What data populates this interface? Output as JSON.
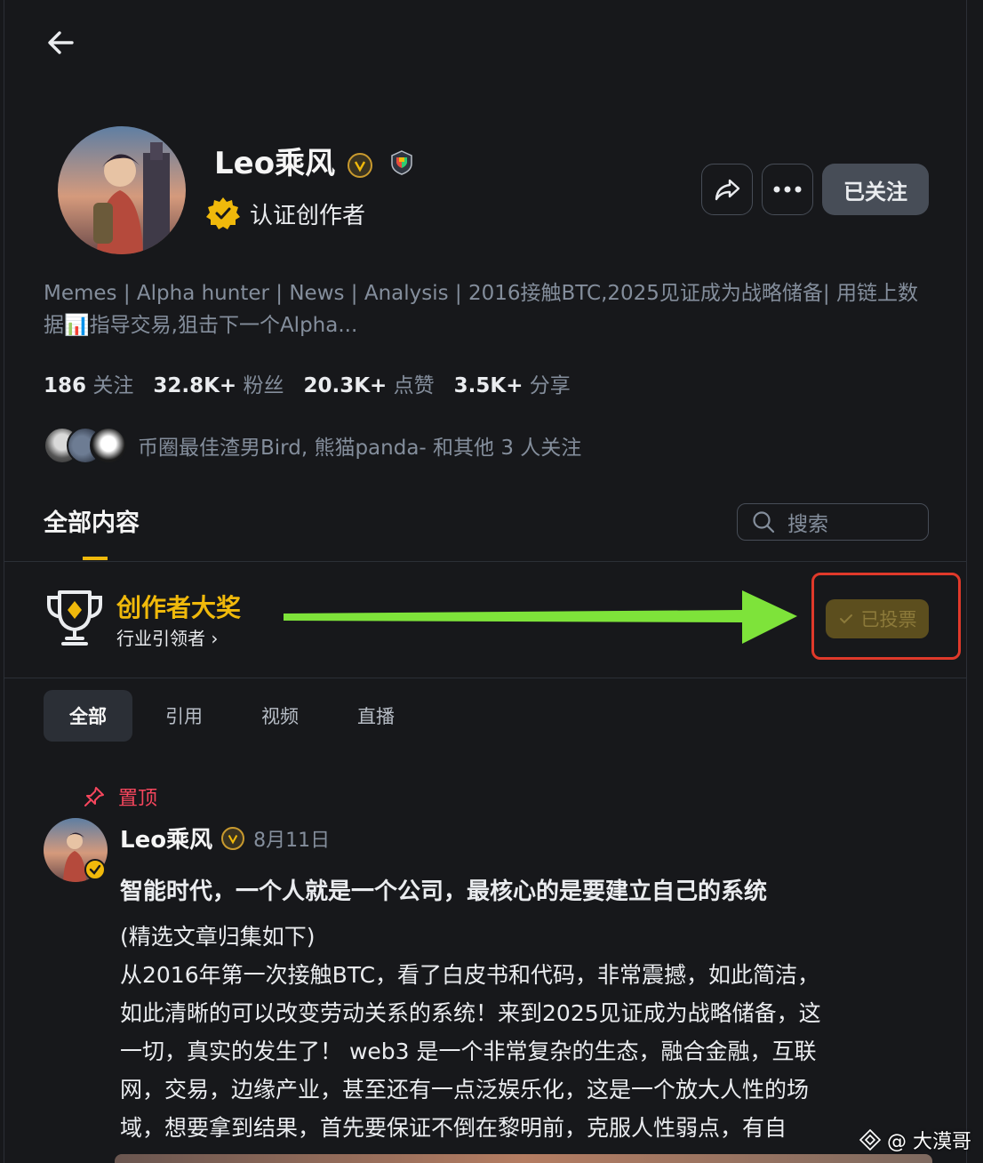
{
  "header": {
    "back_label": "←"
  },
  "profile": {
    "name": "Leo乘风",
    "verified_label": "认证创作者",
    "follow_button": "已关注",
    "bio": "Memes | Alpha hunter | News | Analysis | 2016接触BTC,2025见证成为战略储备| 用链上数据📊指导交易,狙击下一个Alpha...",
    "stats": [
      {
        "value": "186",
        "label": "关注"
      },
      {
        "value": "32.8K+",
        "label": "粉丝"
      },
      {
        "value": "20.3K+",
        "label": "点赞"
      },
      {
        "value": "3.5K+",
        "label": "分享"
      }
    ],
    "mutual_followers": "币圈最佳渣男Bird, 熊猫panda- 和其他 3 人关注"
  },
  "content_tab": {
    "label": "全部内容"
  },
  "search": {
    "placeholder": "搜索"
  },
  "award": {
    "title": "创作者大奖",
    "subtitle": "行业引领者 ›",
    "voted_label": "已投票"
  },
  "filters": [
    "全部",
    "引用",
    "视频",
    "直播"
  ],
  "post": {
    "pinned_label": "置顶",
    "author": "Leo乘风",
    "date": "8月11日",
    "title": "智能时代，一个人就是一个公司，最核心的是要建立自己的系统",
    "body_lines": [
      "(精选文章归集如下)",
      "从2016年第一次接触BTC，看了白皮书和代码，非常震撼，如此简洁，",
      "如此清晰的可以改变劳动关系的系统！来到2025见证成为战略储备，这",
      "一切，真实的发生了！ web3 是一个非常复杂的生态，融合金融，互联",
      "网，交易，边缘产业，甚至还有一点泛娱乐化，这是一个放大人性的场",
      "域，想要拿到结果，首先要保证不倒在黎明前，克服人性弱点，有自"
    ]
  },
  "watermark": "@ 大漠哥",
  "colors": {
    "accent": "#f0b90b",
    "annotation_red": "#e0392a",
    "annotation_arrow": "#7ee33a"
  }
}
